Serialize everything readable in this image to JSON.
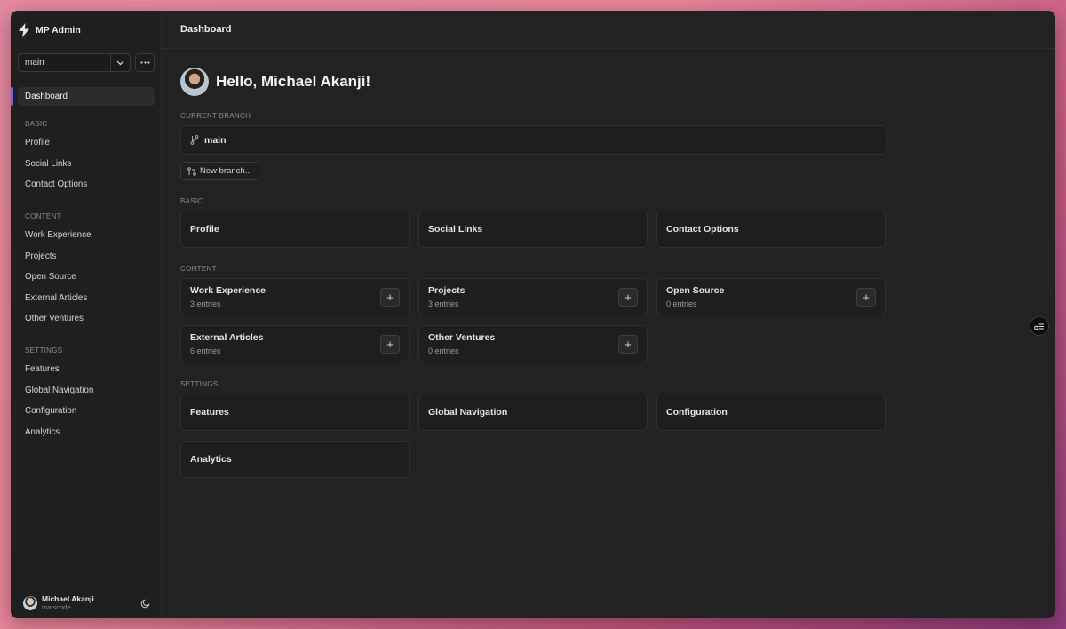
{
  "app": {
    "name": "MP Admin"
  },
  "branch_selector": {
    "value": "main"
  },
  "sidebar": {
    "dashboard": "Dashboard",
    "sections": [
      {
        "title": "BASIC",
        "items": [
          "Profile",
          "Social Links",
          "Contact Options"
        ]
      },
      {
        "title": "CONTENT",
        "items": [
          "Work Experience",
          "Projects",
          "Open Source",
          "External Articles",
          "Other Ventures"
        ]
      },
      {
        "title": "SETTINGS",
        "items": [
          "Features",
          "Global Navigation",
          "Configuration",
          "Analytics"
        ]
      }
    ]
  },
  "user": {
    "name": "Michael Akanji",
    "handle": "matscode"
  },
  "header": {
    "title": "Dashboard"
  },
  "main": {
    "greeting": "Hello, Michael Akanji!",
    "current_branch_label": "CURRENT BRANCH",
    "current_branch": "main",
    "new_branch_label": "New branch...",
    "basic": {
      "label": "BASIC",
      "cards": [
        {
          "title": "Profile"
        },
        {
          "title": "Social Links"
        },
        {
          "title": "Contact Options"
        }
      ]
    },
    "content": {
      "label": "CONTENT",
      "cards": [
        {
          "title": "Work Experience",
          "sub": "3 entries"
        },
        {
          "title": "Projects",
          "sub": "3 entries"
        },
        {
          "title": "Open Source",
          "sub": "0 entries"
        },
        {
          "title": "External Articles",
          "sub": "6 entries"
        },
        {
          "title": "Other Ventures",
          "sub": "0 entries"
        }
      ]
    },
    "settings": {
      "label": "SETTINGS",
      "cards": [
        {
          "title": "Features"
        },
        {
          "title": "Global Navigation"
        },
        {
          "title": "Configuration"
        },
        {
          "title": "Analytics"
        }
      ]
    },
    "plus_symbol": "+"
  },
  "icons": {
    "logo": "lightning-bolt-icon",
    "chevron": "chevron-down-icon",
    "more": "ellipsis-icon",
    "branch": "git-branch-icon",
    "new_branch": "git-compare-icon",
    "theme": "moon-icon",
    "floating": "toolbar-toggle-icon"
  },
  "colors": {
    "accent": "#5b6cf0",
    "background": "#222222",
    "sidebar": "#1f1f1f"
  }
}
